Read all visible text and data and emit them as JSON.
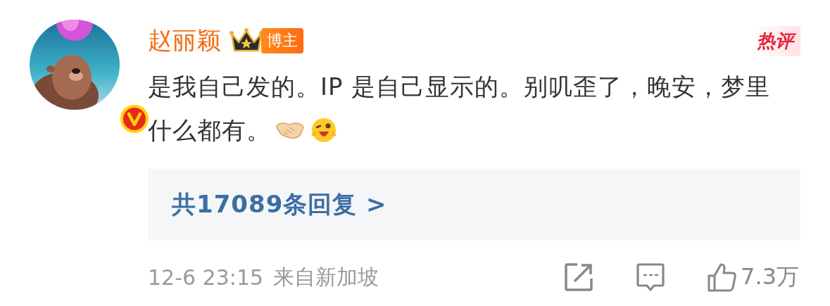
{
  "comment": {
    "author": "赵丽颖",
    "verified": true,
    "author_badge": "博主",
    "hot_label": "热评",
    "text": "是我自己发的。IP 是自己显示的。别叽歪了，晚安，梦里什么都有。",
    "replies_link": "共17089条回复 >",
    "time": "12-6 23:15",
    "source": "来自新加坡",
    "likes": "7.3万"
  }
}
